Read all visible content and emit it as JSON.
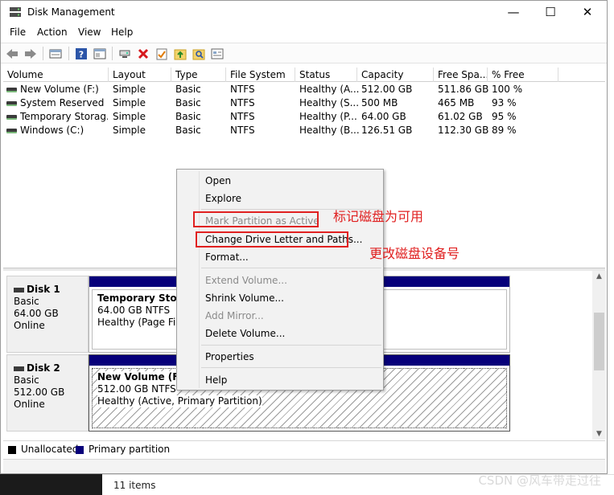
{
  "window": {
    "title": "Disk Management",
    "controls": {
      "minimize": "—",
      "maximize": "☐",
      "close": "✕"
    }
  },
  "menu": [
    "File",
    "Action",
    "View",
    "Help"
  ],
  "toolbar_icons": [
    "back-icon",
    "forward-icon",
    "disk-list-icon",
    "help-icon",
    "properties-icon",
    "connect-icon",
    "delete-icon",
    "check-icon",
    "folder-up-icon",
    "search-icon",
    "console-icon"
  ],
  "volume_list": {
    "columns": [
      "Volume",
      "Layout",
      "Type",
      "File System",
      "Status",
      "Capacity",
      "Free Spa...",
      "% Free"
    ],
    "rows": [
      [
        "New Volume (F:)",
        "Simple",
        "Basic",
        "NTFS",
        "Healthy (A...",
        "512.00 GB",
        "511.86 GB",
        "100 %"
      ],
      [
        "System Reserved",
        "Simple",
        "Basic",
        "NTFS",
        "Healthy (S...",
        "500 MB",
        "465 MB",
        "93 %"
      ],
      [
        "Temporary Storag...",
        "Simple",
        "Basic",
        "NTFS",
        "Healthy (P...",
        "64.00 GB",
        "61.02 GB",
        "95 %"
      ],
      [
        "Windows (C:)",
        "Simple",
        "Basic",
        "NTFS",
        "Healthy (B...",
        "126.51 GB",
        "112.30 GB",
        "89 %"
      ]
    ]
  },
  "disks": [
    {
      "name": "Disk 1",
      "type": "Basic",
      "size": "64.00 GB",
      "state": "Online",
      "partition": {
        "name": "Temporary Storag",
        "size_fs": "64.00 GB NTFS",
        "status": "Healthy (Page File, I"
      }
    },
    {
      "name": "Disk 2",
      "type": "Basic",
      "size": "512.00 GB",
      "state": "Online",
      "partition": {
        "name": "New Volume  (F:)",
        "size_fs": "512.00 GB NTFS",
        "status": "Healthy (Active, Primary Partition)"
      }
    }
  ],
  "legend": [
    {
      "label": "Unallocated",
      "color": "#000000"
    },
    {
      "label": "Primary partition",
      "color": "#07007a"
    }
  ],
  "context_menu": {
    "items": [
      {
        "label": "Open",
        "enabled": true
      },
      {
        "label": "Explore",
        "enabled": true
      },
      {
        "label": "Mark Partition as Active",
        "enabled": false
      },
      {
        "label": "Change Drive Letter and Paths...",
        "enabled": true
      },
      {
        "label": "Format...",
        "enabled": true
      },
      {
        "label": "Extend Volume...",
        "enabled": false
      },
      {
        "label": "Shrink Volume...",
        "enabled": true
      },
      {
        "label": "Add Mirror...",
        "enabled": false
      },
      {
        "label": "Delete Volume...",
        "enabled": true
      },
      {
        "label": "Properties",
        "enabled": true
      },
      {
        "label": "Help",
        "enabled": true
      }
    ]
  },
  "annotations": {
    "mark_active": "标记磁盘为可用",
    "change_letter": "更改磁盘设备号",
    "highlight_color": "#e02020"
  },
  "background": {
    "status_text": "11 items",
    "watermark": "CSDN @风车带走过往"
  }
}
